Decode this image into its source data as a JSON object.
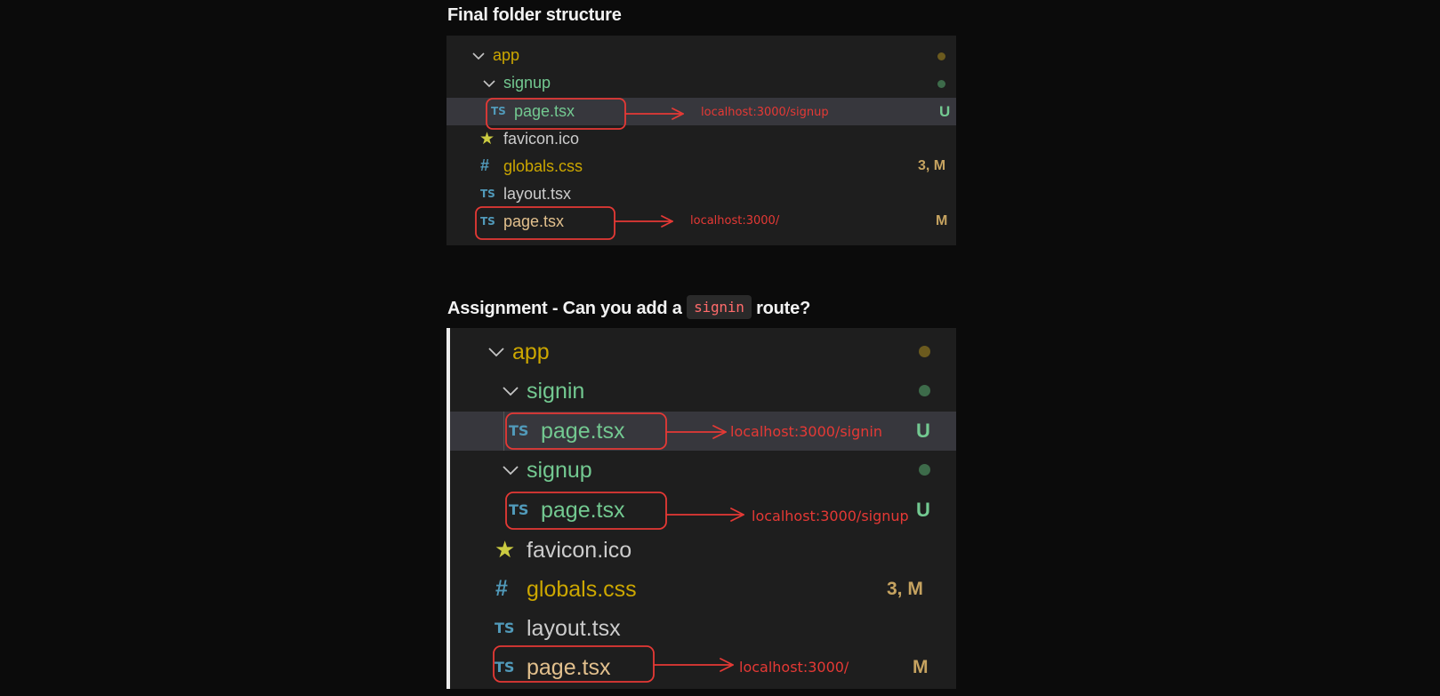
{
  "section1": {
    "title": "Final folder structure",
    "rows": {
      "app": "app",
      "signup": "signup",
      "signup_page": "page.tsx",
      "favicon": "favicon.ico",
      "globals": "globals.css",
      "layout": "layout.tsx",
      "root_page": "page.tsx"
    },
    "badges": {
      "signup_page": "U",
      "globals": "3, M",
      "root_page": "M"
    },
    "annotations": {
      "signup": "localhost:3000/signup",
      "root": "localhost:3000/"
    }
  },
  "section2": {
    "title_prefix": "Assignment - Can you add a",
    "title_code": "signin",
    "title_suffix": "route?",
    "rows": {
      "app": "app",
      "signin": "signin",
      "signin_page": "page.tsx",
      "signup": "signup",
      "signup_page": "page.tsx",
      "favicon": "favicon.ico",
      "globals": "globals.css",
      "layout": "layout.tsx",
      "root_page": "page.tsx"
    },
    "badges": {
      "signin_page": "U",
      "signup_page": "U",
      "globals": "3, M",
      "root_page": "M"
    },
    "annotations": {
      "signin": "localhost:3000/signin",
      "signup": "localhost:3000/signup",
      "root": "localhost:3000/"
    }
  },
  "icons": {
    "ts": "TS",
    "hash": "#",
    "star": "★",
    "chevron": "chevron-down-icon"
  },
  "colors": {
    "annotation": "#e53935",
    "folder": "#cca700",
    "untracked": "#73c991",
    "modified": "#e2c08d"
  }
}
